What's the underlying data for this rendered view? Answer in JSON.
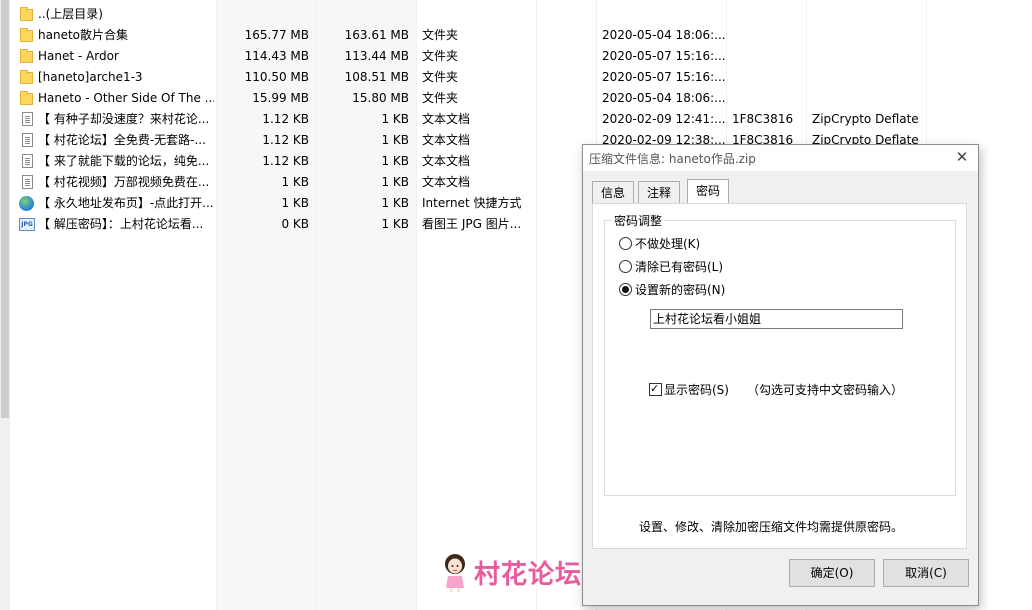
{
  "files": [
    {
      "icon": "folder-icon",
      "name": "..(上层目录)",
      "size": "",
      "packed": "",
      "type": "",
      "modified": "",
      "crc": "",
      "method": ""
    },
    {
      "icon": "folder-icon",
      "name": "haneto散片合集",
      "size": "165.77 MB",
      "packed": "163.61 MB",
      "type": "文件夹",
      "modified": "2020-05-04 18:06:...",
      "crc": "",
      "method": ""
    },
    {
      "icon": "folder-icon",
      "name": "Hanet - Ardor",
      "size": "114.43 MB",
      "packed": "113.44 MB",
      "type": "文件夹",
      "modified": "2020-05-07 15:16:...",
      "crc": "",
      "method": ""
    },
    {
      "icon": "folder-icon",
      "name": "[haneto]arche1-3",
      "size": "110.50 MB",
      "packed": "108.51 MB",
      "type": "文件夹",
      "modified": "2020-05-07 15:16:...",
      "crc": "",
      "method": ""
    },
    {
      "icon": "folder-icon",
      "name": "Haneto - Other Side Of The ...",
      "size": "15.99 MB",
      "packed": "15.80 MB",
      "type": "文件夹",
      "modified": "2020-05-04 18:06:...",
      "crc": "",
      "method": ""
    },
    {
      "icon": "text-file-icon",
      "name": "【 有种子却没速度？来村花论...",
      "size": "1.12 KB",
      "packed": "1 KB",
      "type": "文本文档",
      "modified": "2020-02-09 12:41:...",
      "crc": "1F8C3816",
      "method": "ZipCrypto Deflate"
    },
    {
      "icon": "text-file-icon",
      "name": "【 村花论坛】全免费-无套路-...",
      "size": "1.12 KB",
      "packed": "1 KB",
      "type": "文本文档",
      "modified": "2020-02-09 12:38:...",
      "crc": "1F8C3816",
      "method": "ZipCrypto Deflate"
    },
    {
      "icon": "text-file-icon",
      "name": "【 来了就能下载的论坛，纯免...",
      "size": "1.12 KB",
      "packed": "1 KB",
      "type": "文本文档",
      "modified": "",
      "crc": "",
      "method": ""
    },
    {
      "icon": "text-file-icon",
      "name": "【 村花视频】万部视频免费在...",
      "size": "1 KB",
      "packed": "1 KB",
      "type": "文本文档",
      "modified": "",
      "crc": "",
      "method": ""
    },
    {
      "icon": "globe-icon",
      "name": "【 永久地址发布页】-点此打开...",
      "size": "1 KB",
      "packed": "1 KB",
      "type": "Internet 快捷方式",
      "modified": "",
      "crc": "",
      "method": ""
    },
    {
      "icon": "jpg-file-icon",
      "name": "【 解压密码】：上村花论坛看...",
      "size": "0 KB",
      "packed": "1 KB",
      "type": "看图王 JPG 图片...",
      "modified": "",
      "crc": "",
      "method": ""
    }
  ],
  "dialog": {
    "title": "压缩文件信息: haneto作品.zip",
    "close_glyph": "✕",
    "tabs": [
      "信息",
      "注释",
      "密码"
    ],
    "active_tab": "密码",
    "group_label": "密码调整",
    "options": [
      "不做处理(K)",
      "清除已有密码(L)",
      "设置新的密码(N)"
    ],
    "selected_option": "设置新的密码(N)",
    "password_value": "上村花论坛看小姐姐",
    "show_password_label": "显示密码(S)",
    "show_password_checked": true,
    "show_password_hint": "（勾选可支持中文密码输入）",
    "note": "设置、修改、清除加密压缩文件均需提供原密码。",
    "ok_label": "确定(O)",
    "cancel_label": "取消(C)"
  },
  "watermark": {
    "text": "村花论坛",
    "color": "#e85b9d"
  },
  "colors": {
    "accent": "#e85b9d",
    "shaded_column": "#f7f7f7"
  }
}
